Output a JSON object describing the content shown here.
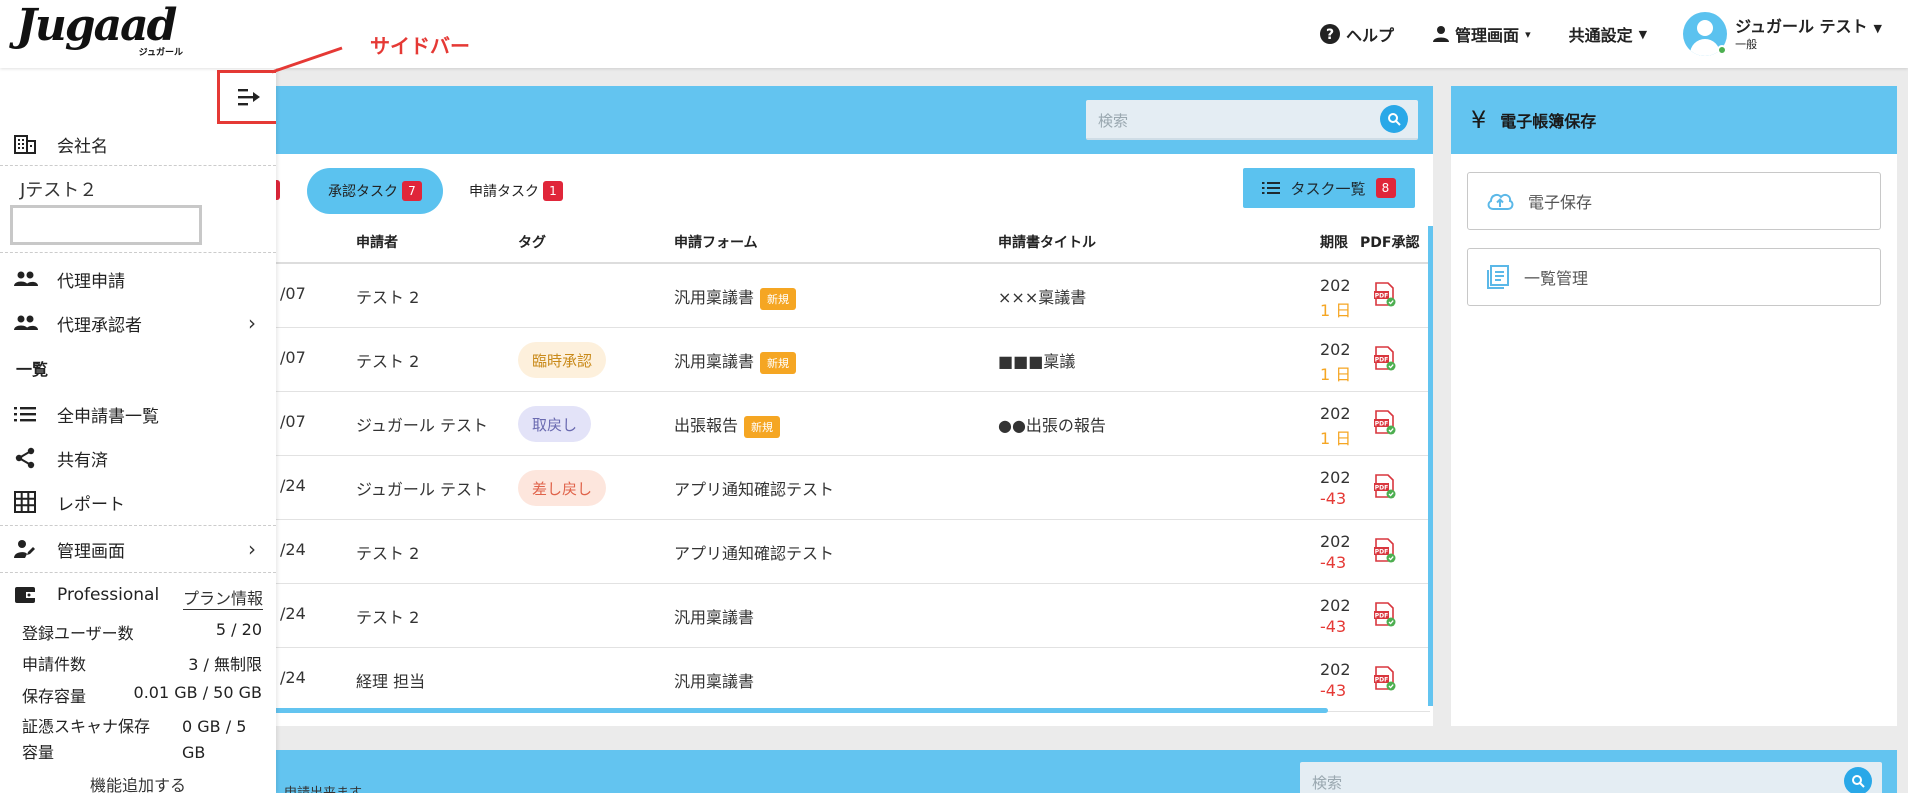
{
  "header": {
    "logo_text": "Jugaad",
    "logo_sub": "ジュガール",
    "help": "ヘルプ",
    "admin": "管理画面",
    "common_settings": "共通設定",
    "user_name": "ジュガール テスト",
    "user_role": "一般"
  },
  "annotation": {
    "label": "サイドバー",
    "color": "#e53935"
  },
  "sidebar": {
    "company_label": "会社名",
    "company_name": "Jテスト２",
    "proxy_apply": "代理申請",
    "proxy_approver": "代理承認者",
    "list_section": "一覧",
    "all_applications": "全申請書一覧",
    "shared": "共有済",
    "report": "レポート",
    "admin": "管理画面",
    "plan": "Professional",
    "plan_info": "プラン情報",
    "stats": [
      {
        "label": "登録ユーザー数",
        "value": "5 / 20"
      },
      {
        "label": "申請件数",
        "value": "3 / 無制限"
      },
      {
        "label": "保存容量",
        "value": "0.01 GB / 50 GB"
      }
    ],
    "scanner_label_1": "証憑スキャナ保存",
    "scanner_label_2": "容量",
    "scanner_value_1": "0 GB / 5",
    "scanner_value_2": "GB",
    "add_feature": "機能追加する"
  },
  "main": {
    "search_placeholder": "検索",
    "tabs": [
      {
        "label": "承認タスク",
        "count": "7",
        "active": true
      },
      {
        "label": "申請タスク",
        "count": "1",
        "active": false
      }
    ],
    "task_list_label": "タスク一覧",
    "task_list_count": "8",
    "columns": {
      "applicant": "申請者",
      "tag": "タグ",
      "form": "申請フォーム",
      "title": "申請書タイトル",
      "deadline": "期限",
      "pdf": "PDF承認"
    },
    "rows": [
      {
        "date": "/07",
        "applicant": "テスト 2",
        "tag": "",
        "form": "汎用稟議書",
        "is_new": true,
        "title": "×××稟議書",
        "deadline_year": "202",
        "deadline_day": "1 日"
      },
      {
        "date": "/07",
        "applicant": "テスト 2",
        "tag": "臨時承認",
        "form": "汎用稟議書",
        "is_new": true,
        "title": "■■■稟議",
        "deadline_year": "202",
        "deadline_day": "1 日"
      },
      {
        "date": "/07",
        "applicant": "ジュガール テスト",
        "tag": "取戻し",
        "form": "出張報告",
        "is_new": true,
        "title": "●●出張の報告",
        "deadline_year": "202",
        "deadline_day": "1 日"
      },
      {
        "date": "/24",
        "applicant": "ジュガール テスト",
        "tag": "差し戻し",
        "form": "アプリ通知確認テスト",
        "is_new": false,
        "title": "",
        "deadline_year": "202",
        "deadline_day": "-43"
      },
      {
        "date": "/24",
        "applicant": "テスト 2",
        "tag": "",
        "form": "アプリ通知確認テスト",
        "is_new": false,
        "title": "",
        "deadline_year": "202",
        "deadline_day": "-43"
      },
      {
        "date": "/24",
        "applicant": "テスト 2",
        "tag": "",
        "form": "汎用稟議書",
        "is_new": false,
        "title": "",
        "deadline_year": "202",
        "deadline_day": "-43"
      },
      {
        "date": "/24",
        "applicant": "経理 担当",
        "tag": "",
        "form": "汎用稟議書",
        "is_new": false,
        "title": "",
        "deadline_year": "202",
        "deadline_day": "-43"
      }
    ],
    "new_label": "新規"
  },
  "tag_styles": {
    "臨時承認": {
      "bg": "#fdf0dc",
      "fg": "#c98a1a"
    },
    "取戻し": {
      "bg": "#e3e3f8",
      "fg": "#6a6ab0"
    },
    "差し戻し": {
      "bg": "#fde6dd",
      "fg": "#e0634a"
    }
  },
  "colors": {
    "accent": "#63c4f0",
    "badge": "#e0263a",
    "deadline_ok": "#f5a623",
    "deadline_over": "#e53935"
  },
  "right": {
    "title": "電子帳簿保存",
    "yen": "¥",
    "e_storage": "電子保存",
    "list_management": "一覧管理"
  },
  "bottom": {
    "search_placeholder": "検索",
    "partial_text": "申請出来ます"
  }
}
